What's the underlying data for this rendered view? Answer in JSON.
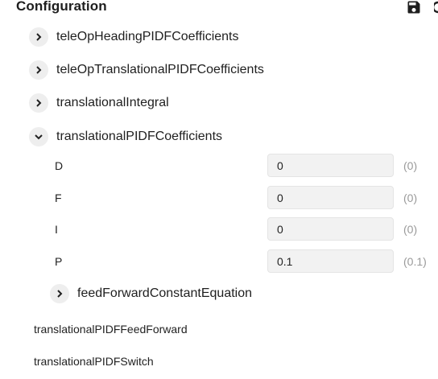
{
  "header": {
    "title": "Configuration",
    "save_icon": "save-icon",
    "partial_icon": "content-copy-icon"
  },
  "tree": [
    {
      "label": "teleOpHeadingPIDFCoefficients",
      "expanded": false,
      "icon": "chevron-right-icon"
    },
    {
      "label": "teleOpTranslationalPIDFCoefficients",
      "expanded": false,
      "icon": "chevron-right-icon"
    },
    {
      "label": "translationalIntegral",
      "expanded": false,
      "icon": "chevron-right-icon"
    },
    {
      "label": "translationalPIDFCoefficients",
      "expanded": true,
      "icon": "chevron-down-icon"
    }
  ],
  "params": [
    {
      "name": "D",
      "value": "0",
      "default": "(0)"
    },
    {
      "name": "F",
      "value": "0",
      "default": "(0)"
    },
    {
      "name": "I",
      "value": "0",
      "default": "(0)"
    },
    {
      "name": "P",
      "value": "0.1",
      "default": "(0.1)"
    }
  ],
  "subtree": {
    "label": "feedForwardConstantEquation",
    "expanded": false,
    "icon": "chevron-right-icon"
  },
  "plain_items": [
    {
      "label": "translationalPIDFFeedForward"
    },
    {
      "label": "translationalPIDFSwitch"
    }
  ]
}
